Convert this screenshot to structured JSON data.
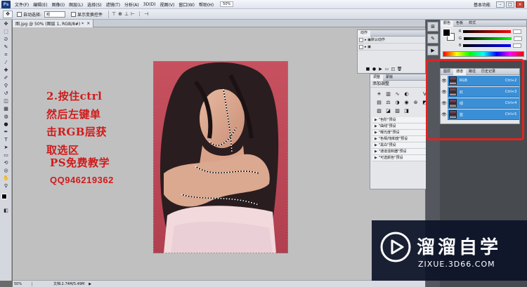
{
  "menubar": {
    "logo": "Ps",
    "items": [
      "文件(F)",
      "编辑(E)",
      "图像(I)",
      "图层(L)",
      "选择(S)",
      "滤镜(T)",
      "分析(A)",
      "3D(D)",
      "视图(V)",
      "窗口(W)",
      "帮助(H)"
    ],
    "zoom": "50%",
    "workspace": "基本功能",
    "win_min": "–",
    "win_max": "□",
    "win_close": "×"
  },
  "options": {
    "auto_select": "自动选择:",
    "auto_select_value": "组",
    "show_transform": "显示变换控件"
  },
  "document": {
    "tab": "图.jpg @ 50% (图层 1, RGB/8#) *",
    "tab_close": "×",
    "status_zoom": "50%",
    "status_doc": "文档:2.74M/5.49M",
    "status_arrow": "▶"
  },
  "annotation": {
    "line1": "2.按住ctrl",
    "line2": "然后左键单",
    "line3": "击RGB层获",
    "line4": "取选区",
    "line5": "PS免费教学",
    "line6": "QQ946219362"
  },
  "actions_panel": {
    "tabs": [
      "动作"
    ],
    "rows": [
      "默认动作",
      ""
    ]
  },
  "adjustments_panel": {
    "tabs": [
      "调整",
      "蒙版"
    ],
    "title": "添加调整",
    "presets": [
      "\"色阶\"预设",
      "\"曲线\"预设",
      "\"曝光度\"预设",
      "\"色相/饱和度\"预设",
      "\"黑白\"预设",
      "\"通道混和器\"预设",
      "\"可选颜色\"预设"
    ]
  },
  "color_panel": {
    "tabs": [
      "颜色",
      "色板",
      "样式"
    ],
    "r_label": "R",
    "g_label": "G",
    "b_label": "B"
  },
  "channels_panel": {
    "tabs": [
      "图层",
      "通道",
      "路径",
      "历史记录"
    ],
    "channels": [
      {
        "name": "RGB",
        "key": "Ctrl+2"
      },
      {
        "name": "红",
        "key": "Ctrl+3"
      },
      {
        "name": "绿",
        "key": "Ctrl+4"
      },
      {
        "name": "蓝",
        "key": "Ctrl+5"
      }
    ]
  },
  "watermark": {
    "title": "溜溜自学",
    "url": "ZIXUE.3D66.COM"
  },
  "colors": {
    "annotation": "#d11a1a",
    "highlight": "#e3231f",
    "channel_selected": "#3a8fd6",
    "canvas": "#c0c0c0"
  }
}
